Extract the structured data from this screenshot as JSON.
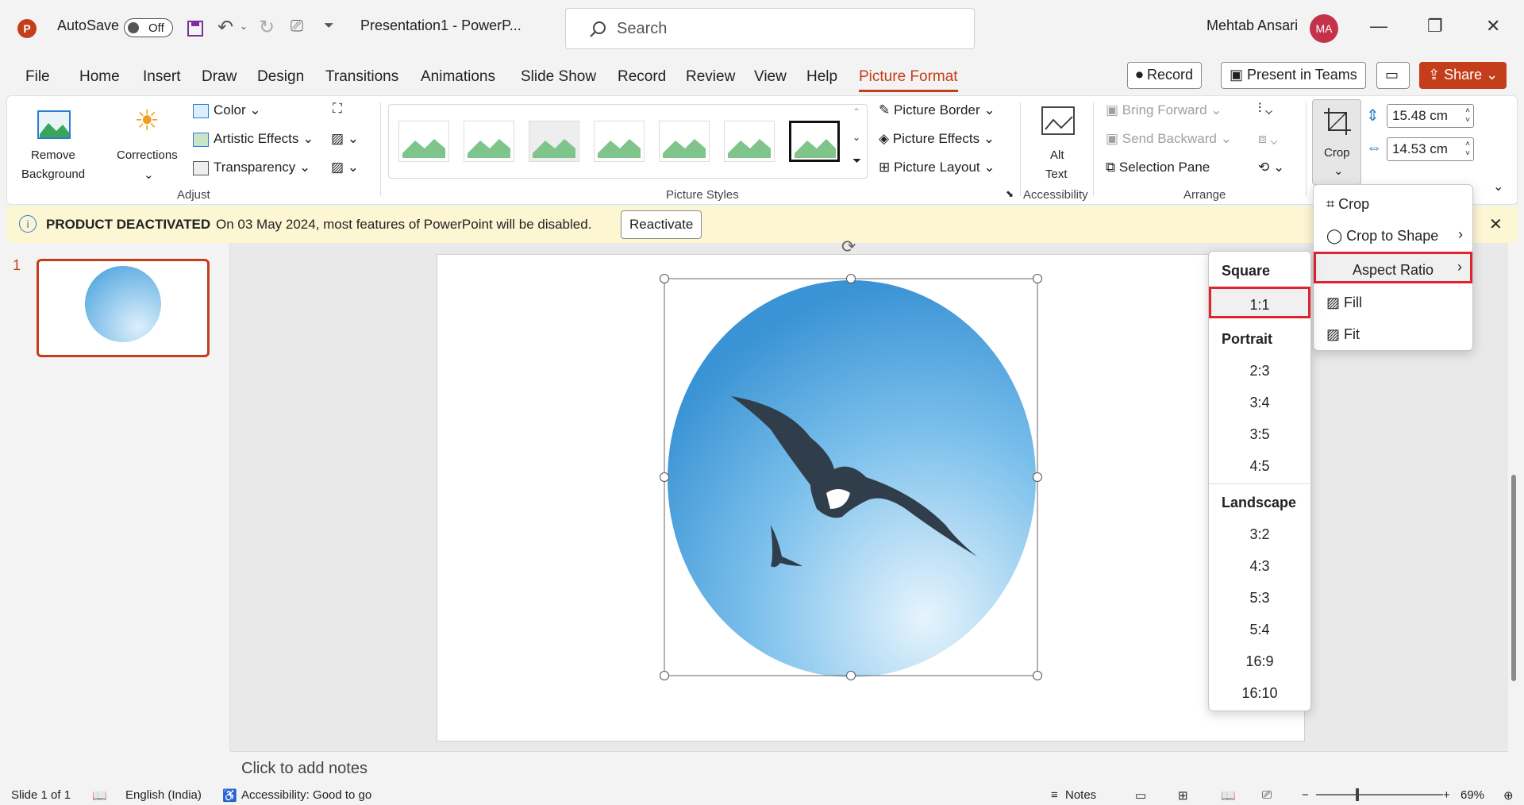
{
  "titlebar": {
    "autosave_label": "AutoSave",
    "autosave_state": "Off",
    "doc_title": "Presentation1  -  PowerP...",
    "search_placeholder": "Search",
    "user_name": "Mehtab Ansari",
    "user_initials": "MA"
  },
  "tabs": [
    "File",
    "Home",
    "Insert",
    "Draw",
    "Design",
    "Transitions",
    "Animations",
    "Slide Show",
    "Record",
    "Review",
    "View",
    "Help",
    "Picture Format"
  ],
  "topbuttons": {
    "record": "Record",
    "present": "Present in Teams",
    "share": "Share"
  },
  "ribbon": {
    "remove_bg": [
      "Remove",
      "Background"
    ],
    "corrections": "Corrections",
    "color": "Color",
    "artistic": "Artistic Effects",
    "transparency": "Transparency",
    "adjust_label": "Adjust",
    "picture_styles_label": "Picture Styles",
    "picture_border": "Picture Border",
    "picture_effects": "Picture Effects",
    "picture_layout": "Picture Layout",
    "alt_text": [
      "Alt",
      "Text"
    ],
    "accessibility_label": "Accessibility",
    "bring_forward": "Bring Forward",
    "send_backward": "Send Backward",
    "selection_pane": "Selection Pane",
    "arrange_label": "Arrange",
    "crop": "Crop",
    "height": "15.48 cm",
    "width": "14.53 cm"
  },
  "notification": {
    "title": "PRODUCT DEACTIVATED",
    "message": "On 03 May 2024, most features of PowerPoint will be disabled.",
    "button": "Reactivate"
  },
  "thumbs": {
    "slide_number": "1"
  },
  "notes_placeholder": "Click to add notes",
  "crop_menu": {
    "items": [
      "Crop",
      "Crop to Shape",
      "Aspect Ratio",
      "Fill",
      "Fit"
    ]
  },
  "aspect_menu": {
    "square_header": "Square",
    "square": [
      "1:1"
    ],
    "portrait_header": "Portrait",
    "portrait": [
      "2:3",
      "3:4",
      "3:5",
      "4:5"
    ],
    "landscape_header": "Landscape",
    "landscape": [
      "3:2",
      "4:3",
      "5:3",
      "5:4",
      "16:9",
      "16:10"
    ]
  },
  "status": {
    "slide": "Slide 1 of 1",
    "language": "English (India)",
    "accessibility": "Accessibility: Good to go",
    "notes": "Notes",
    "zoom": "69%"
  },
  "colors": {
    "accent": "#c43e1c",
    "highlight": "#e0242f",
    "notif_bg": "#fdf6d3"
  }
}
